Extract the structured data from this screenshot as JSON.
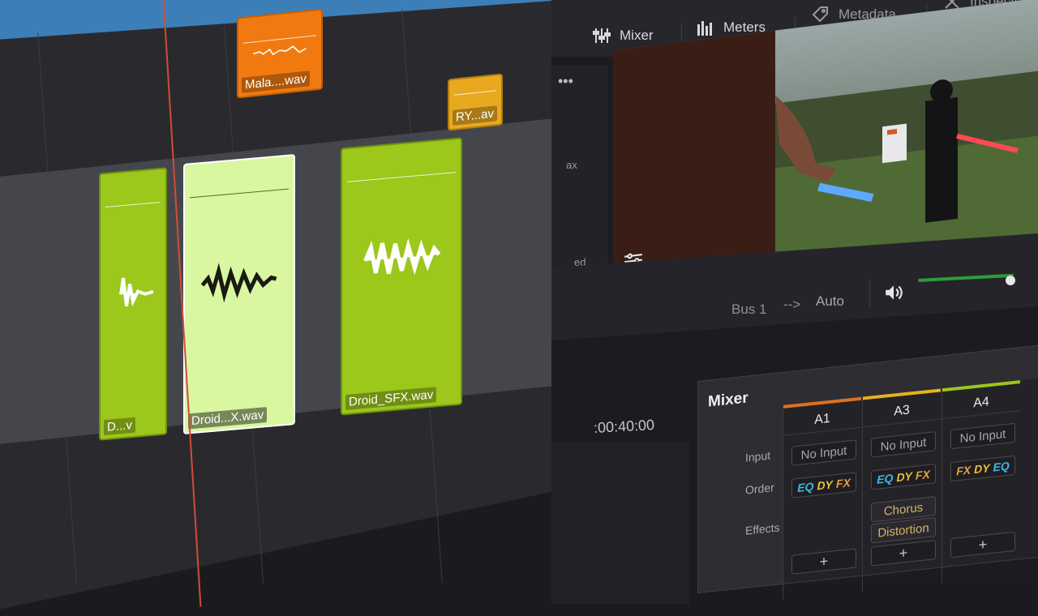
{
  "timeline": {
    "clips": [
      {
        "label": "Mala....wav",
        "color": "#f07a10"
      },
      {
        "label": "RY...av",
        "color": "#e8a820"
      },
      {
        "label": "D...v",
        "color": "#9cc71b"
      },
      {
        "label": "Droid...X.wav",
        "color": "#d8f7a0"
      },
      {
        "label": "Droid_SFX.wav",
        "color": "#9cc71b"
      }
    ]
  },
  "tabs": [
    {
      "label": "Mixer",
      "icon": "mixer-sliders-icon"
    },
    {
      "label": "Meters",
      "icon": "meters-bars-icon"
    },
    {
      "label": "Metadata",
      "icon": "metadata-tags-icon"
    },
    {
      "label": "Inspecto",
      "icon": "inspector-tools-icon"
    }
  ],
  "side_panel": {
    "text_a": "ax",
    "text_b": "ed"
  },
  "viewer": {
    "icon": "viewer-settings-icon"
  },
  "bus": {
    "label": "Bus 1",
    "arrow": "-->",
    "mode": "Auto"
  },
  "timecode": ":00:40:00",
  "mixer": {
    "title": "Mixer",
    "row_labels": {
      "input": "Input",
      "order": "Order",
      "effects": "Effects"
    },
    "channels": [
      {
        "name": "A1",
        "color": "#e07020",
        "input": "No Input",
        "order": [
          "EQ",
          "DY",
          "FX"
        ],
        "effects": [],
        "add": "+"
      },
      {
        "name": "A3",
        "color": "#e6b21e",
        "input": "No Input",
        "order": [
          "EQ",
          "DY",
          "FX"
        ],
        "effects": [
          "Chorus",
          "Distortion"
        ],
        "add": "+"
      },
      {
        "name": "A4",
        "color": "#9cc71b",
        "input": "No Input",
        "order": [
          "FX",
          "DY",
          "EQ"
        ],
        "effects": [],
        "add": "+"
      }
    ]
  }
}
